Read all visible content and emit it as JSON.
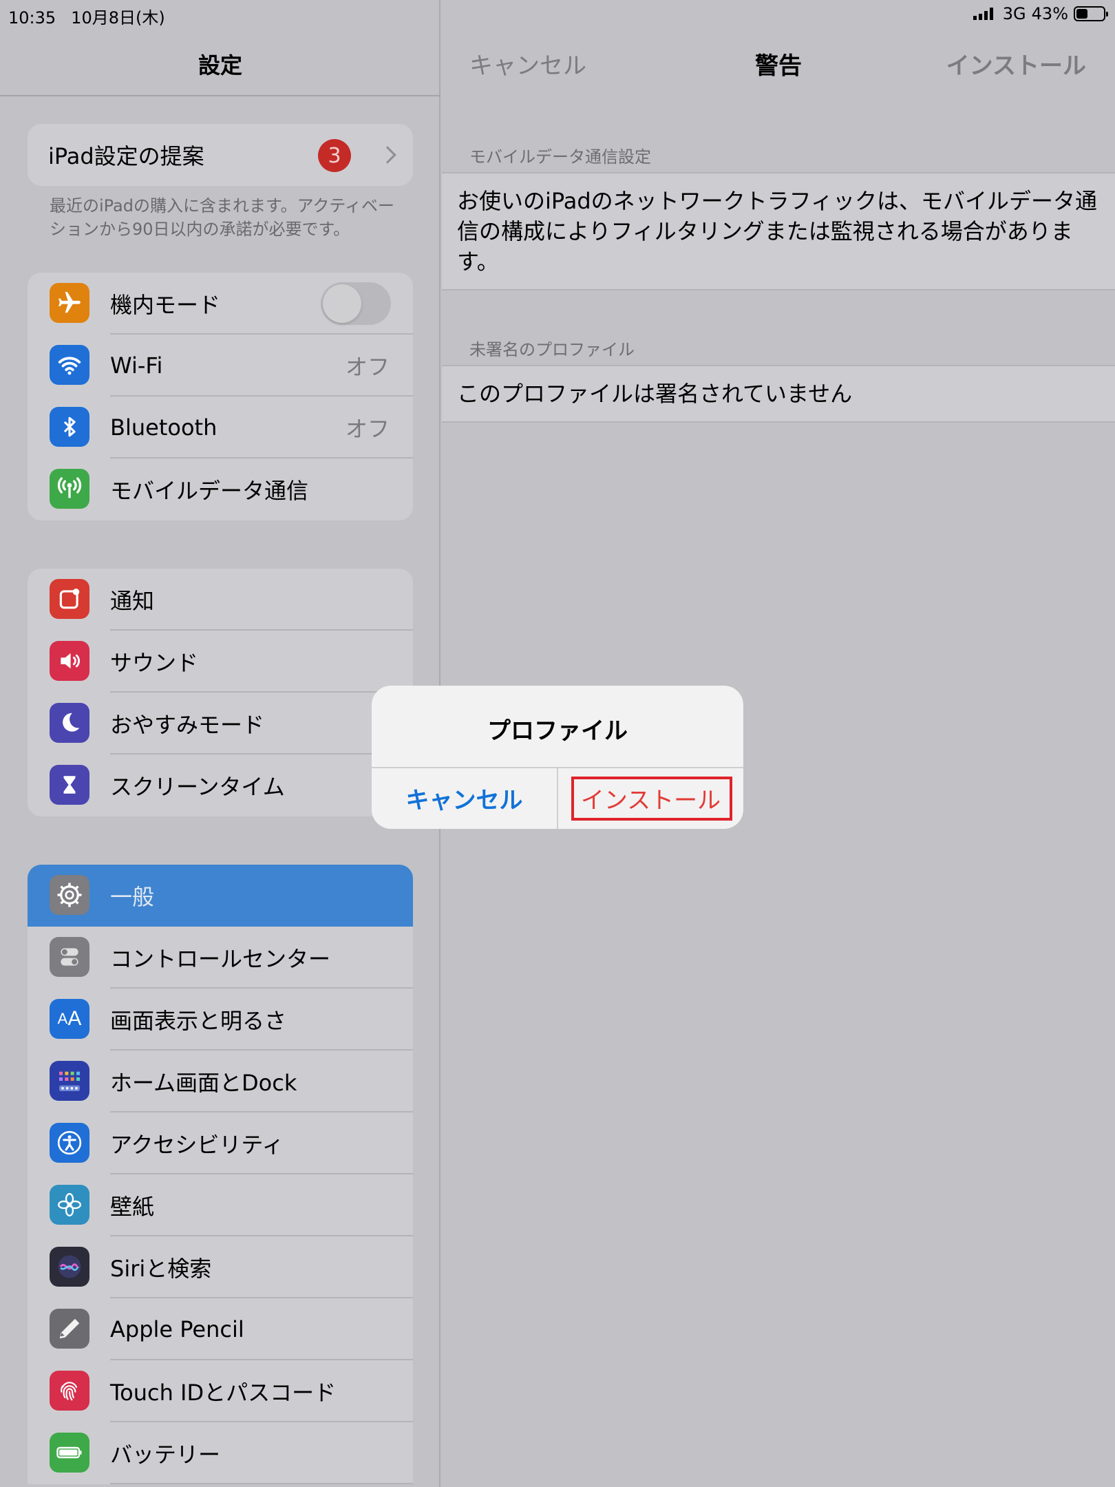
{
  "status_bar": {
    "time": "10:35",
    "date": "10月8日(木)",
    "network": "3G",
    "battery": "43%",
    "battery_fraction": 0.43
  },
  "sidebar": {
    "title": "設定",
    "suggestion": {
      "label": "iPad設定の提案",
      "badge": "3"
    },
    "note": "最近のiPadの購入に含まれます。アクティベーションから90日以内の承諾が必要です。",
    "group1": [
      {
        "label": "機内モード",
        "value": "",
        "icon": "airplane-icon",
        "color": "#e0820e"
      },
      {
        "label": "Wi-Fi",
        "value": "オフ",
        "icon": "wifi-icon",
        "color": "#1f6fd6"
      },
      {
        "label": "Bluetooth",
        "value": "オフ",
        "icon": "bluetooth-icon",
        "color": "#1f6fd6"
      },
      {
        "label": "モバイルデータ通信",
        "value": "",
        "icon": "antenna-icon",
        "color": "#3ea948"
      }
    ],
    "group2": [
      {
        "label": "通知",
        "icon": "notification-icon",
        "color": "#d63a31"
      },
      {
        "label": "サウンド",
        "icon": "speaker-icon",
        "color": "#d62e4b"
      },
      {
        "label": "おやすみモード",
        "icon": "moon-icon",
        "color": "#4b45b0"
      },
      {
        "label": "スクリーンタイム",
        "icon": "hourglass-icon",
        "color": "#4b45b0"
      }
    ],
    "group3": [
      {
        "label": "一般",
        "icon": "gear-icon",
        "color": "#7d7d82"
      },
      {
        "label": "コントロールセンター",
        "icon": "switches-icon",
        "color": "#7d7d82"
      },
      {
        "label": "画面表示と明るさ",
        "icon": "text-size-icon",
        "color": "#1f6fd6"
      },
      {
        "label": "ホーム画面とDock",
        "icon": "home-grid-icon",
        "color": "#2c3fa8"
      },
      {
        "label": "アクセシビリティ",
        "icon": "accessibility-icon",
        "color": "#1f6fd6"
      },
      {
        "label": "壁紙",
        "icon": "flower-icon",
        "color": "#2f8fbf"
      },
      {
        "label": "Siriと検索",
        "icon": "siri-icon",
        "color": "#2b2b3a"
      },
      {
        "label": "Apple Pencil",
        "icon": "pencil-icon",
        "color": "#6b6b70"
      },
      {
        "label": "Touch IDとパスコード",
        "icon": "fingerprint-icon",
        "color": "#d62e4b"
      },
      {
        "label": "バッテリー",
        "icon": "battery-icon",
        "color": "#3ea948"
      }
    ]
  },
  "detail": {
    "nav_cancel": "キャンセル",
    "nav_title": "警告",
    "nav_install": "インストール",
    "section1_header": "モバイルデータ通信設定",
    "section1_text": "お使いのiPadのネットワークトラフィックは、モバイルデータ通信の構成によりフィルタリングまたは監視される場合があります。",
    "section2_header": "未署名のプロファイル",
    "section2_text": "このプロファイルは署名されていません"
  },
  "dialog": {
    "title": "プロファイル",
    "cancel": "キャンセル",
    "install": "インストール"
  }
}
